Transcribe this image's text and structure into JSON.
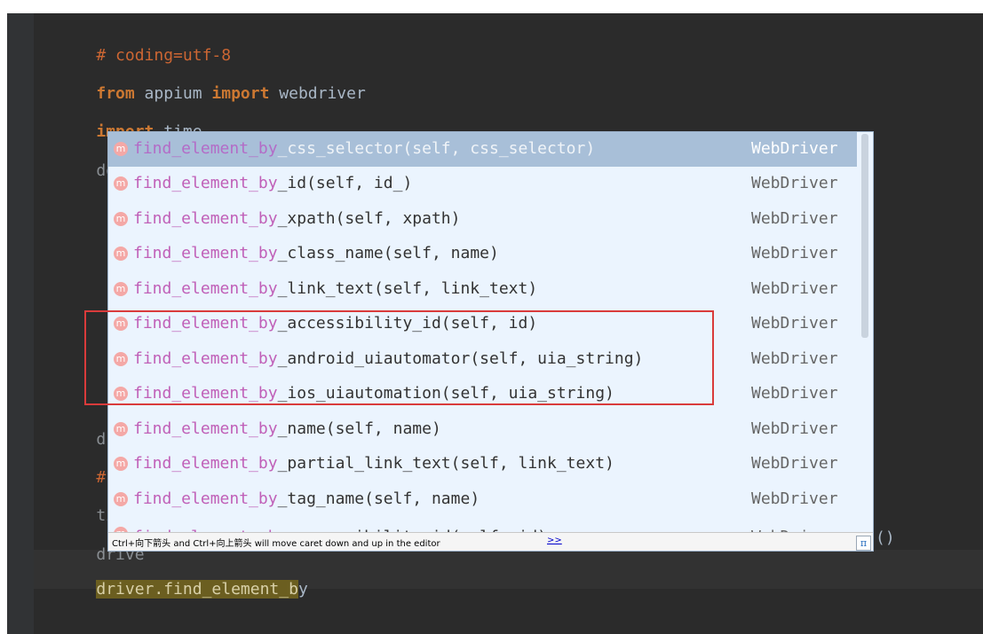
{
  "code_lines": [
    {
      "id": "l1",
      "parts": [
        "# coding=utf-8"
      ]
    },
    {
      "id": "l2",
      "parts": [
        "from",
        " appium ",
        "import",
        " webdriver"
      ]
    },
    {
      "id": "l3",
      "parts": [
        "import",
        " time"
      ]
    },
    {
      "id": "l4",
      "parts": [
        "desi"
      ]
    },
    {
      "id": "l5",
      "parts": [
        "drive"
      ]
    },
    {
      "id": "l6",
      "parts": [
        "# 休"
      ]
    },
    {
      "id": "l7",
      "parts": [
        "time."
      ]
    },
    {
      "id": "l8",
      "parts": [
        "drive"
      ]
    }
  ],
  "trail_text": "()",
  "current_line": {
    "highlighted": "driver.find_element_b",
    "rest": "y"
  },
  "completion_items": [
    {
      "icon": "m",
      "prefix": "find_element_by",
      "suffix": "_css_selector",
      "signature": "(self, css_selector)",
      "type": "WebDriver",
      "selected": true
    },
    {
      "icon": "m",
      "prefix": "find_element_by",
      "suffix": "_id",
      "signature": "(self, id_)",
      "type": "WebDriver"
    },
    {
      "icon": "m",
      "prefix": "find_element_by",
      "suffix": "_xpath",
      "signature": "(self, xpath)",
      "type": "WebDriver"
    },
    {
      "icon": "m",
      "prefix": "find_element_by",
      "suffix": "_class_name",
      "signature": "(self, name)",
      "type": "WebDriver"
    },
    {
      "icon": "m",
      "prefix": "find_element_by",
      "suffix": "_link_text",
      "signature": "(self, link_text)",
      "type": "WebDriver"
    },
    {
      "icon": "m",
      "prefix": "find_element_by",
      "suffix": "_accessibility_id",
      "signature": "(self, id)",
      "type": "WebDriver"
    },
    {
      "icon": "m",
      "prefix": "find_element_by",
      "suffix": "_android_uiautomator",
      "signature": "(self, uia_string)",
      "type": "WebDriver"
    },
    {
      "icon": "m",
      "prefix": "find_element_by",
      "suffix": "_ios_uiautomation",
      "signature": "(self, uia_string)",
      "type": "WebDriver"
    },
    {
      "icon": "m",
      "prefix": "find_element_by",
      "suffix": "_name",
      "signature": "(self, name)",
      "type": "WebDriver"
    },
    {
      "icon": "m",
      "prefix": "find_element_by",
      "suffix": "_partial_link_text",
      "signature": "(self, link_text)",
      "type": "WebDriver"
    },
    {
      "icon": "m",
      "prefix": "find_element_by",
      "suffix": "_tag_name",
      "signature": "(self, name)",
      "type": "WebDriver"
    },
    {
      "icon": "m",
      "prefix": "find_elements_by",
      "suffix": "_accessibility_id",
      "signature": "(self, id)",
      "type": "WebDriver"
    }
  ],
  "footer": {
    "hint": "Ctrl+向下箭头 and Ctrl+向上箭头 will move caret down and up in the editor",
    "link": ">>",
    "icon": "π"
  },
  "colors": {
    "editor_bg": "#2b2b2b",
    "popup_bg": "#ebf4fe",
    "selection": "#a8bfd8",
    "annotation_box": "#d93b3b"
  }
}
